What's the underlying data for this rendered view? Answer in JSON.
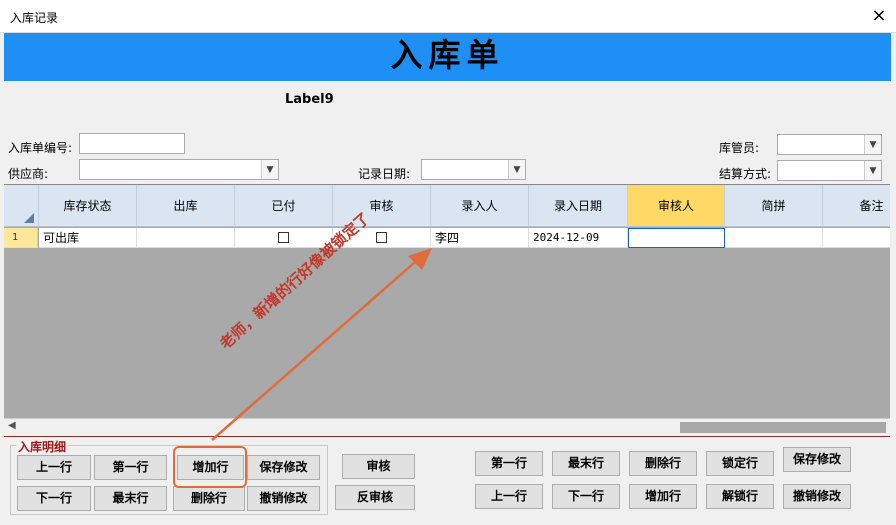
{
  "window": {
    "title": "入库记录",
    "close_icon": "×"
  },
  "banner": {
    "text": "入库单",
    "color": "#1e8ff5"
  },
  "label9": "Label9",
  "form": {
    "order_no_label": "入库单编号:",
    "order_no_value": "",
    "supplier_label": "供应商:",
    "supplier_value": "",
    "record_date_label": "记录日期:",
    "record_date_value": "",
    "warehouse_keeper_label": "库管员:",
    "warehouse_keeper_value": "",
    "settlement_label": "结算方式:",
    "settlement_value": ""
  },
  "grid": {
    "columns": [
      "库存状态",
      "出库",
      "已付",
      "审核",
      "录入人",
      "录入日期",
      "审核人",
      "简拼",
      "备注"
    ],
    "rows": [
      {
        "num": "1",
        "status": "可出库",
        "outbound": "",
        "paid": false,
        "audited": false,
        "entered_by": "李四",
        "entry_date": "2024-12-09",
        "auditor": "",
        "abbrev": "",
        "remark": ""
      }
    ]
  },
  "detail_group": {
    "title": "入库明细",
    "buttons": {
      "prev": "上一行",
      "first": "第一行",
      "add": "增加行",
      "save": "保存修改",
      "next": "下一行",
      "last": "最末行",
      "delete": "删除行",
      "cancel": "撤销修改"
    }
  },
  "audit_buttons": {
    "audit": "审核",
    "unaudit": "反审核"
  },
  "right_buttons": {
    "first": "第一行",
    "last": "最末行",
    "delete": "删除行",
    "lock": "锁定行",
    "save": "保存修改",
    "prev": "上一行",
    "next": "下一行",
    "add": "增加行",
    "unlock": "解锁行",
    "cancel": "撤销修改"
  },
  "annotation": {
    "text": "老师，新增的行好像被锁定了",
    "color": "#e06c3c"
  }
}
